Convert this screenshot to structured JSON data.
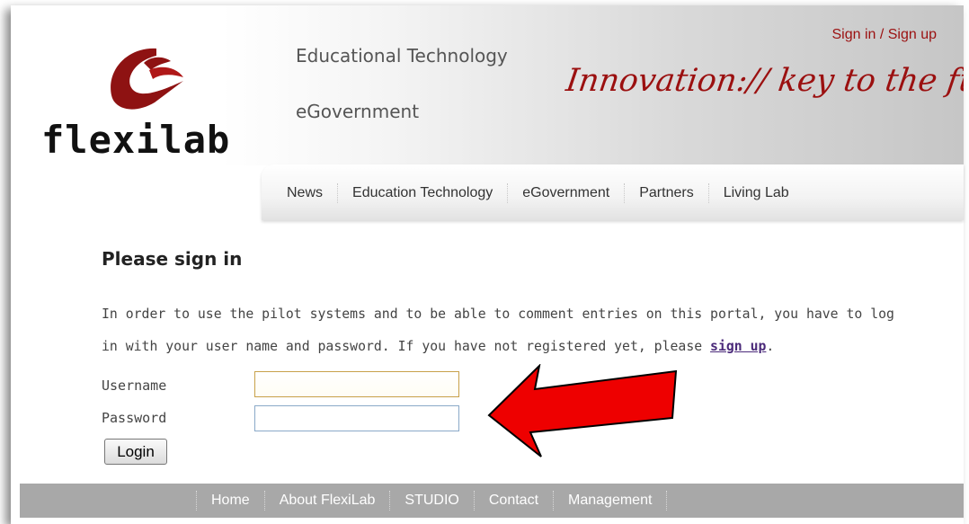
{
  "header": {
    "brand": "flexilab",
    "taglines": [
      "Educational Technology",
      "eGovernment"
    ],
    "slogan": "Innovation:// key to the future",
    "signin_link": "Sign in / Sign up",
    "brand_color": "#9b1010"
  },
  "topnav": {
    "items": [
      "News",
      "Education Technology",
      "eGovernment",
      "Partners",
      "Living Lab"
    ]
  },
  "main": {
    "heading": "Please sign in",
    "intro_text": "In order to use the pilot systems and to be able to comment entries on this portal, you have to log in with your user name and password. If you have not registered yet, please ",
    "signup_link": "sign up",
    "intro_end": "."
  },
  "form": {
    "username_label": "Username",
    "password_label": "Password",
    "username_value": "",
    "password_value": "",
    "login_label": "Login"
  },
  "annotation": {
    "arrow_color": "#ee0000",
    "arrow_icon": "left-pointing-arrow-icon"
  },
  "footer": {
    "items": [
      "Home",
      "About FlexiLab",
      "STUDIO",
      "Contact",
      "Management"
    ]
  }
}
